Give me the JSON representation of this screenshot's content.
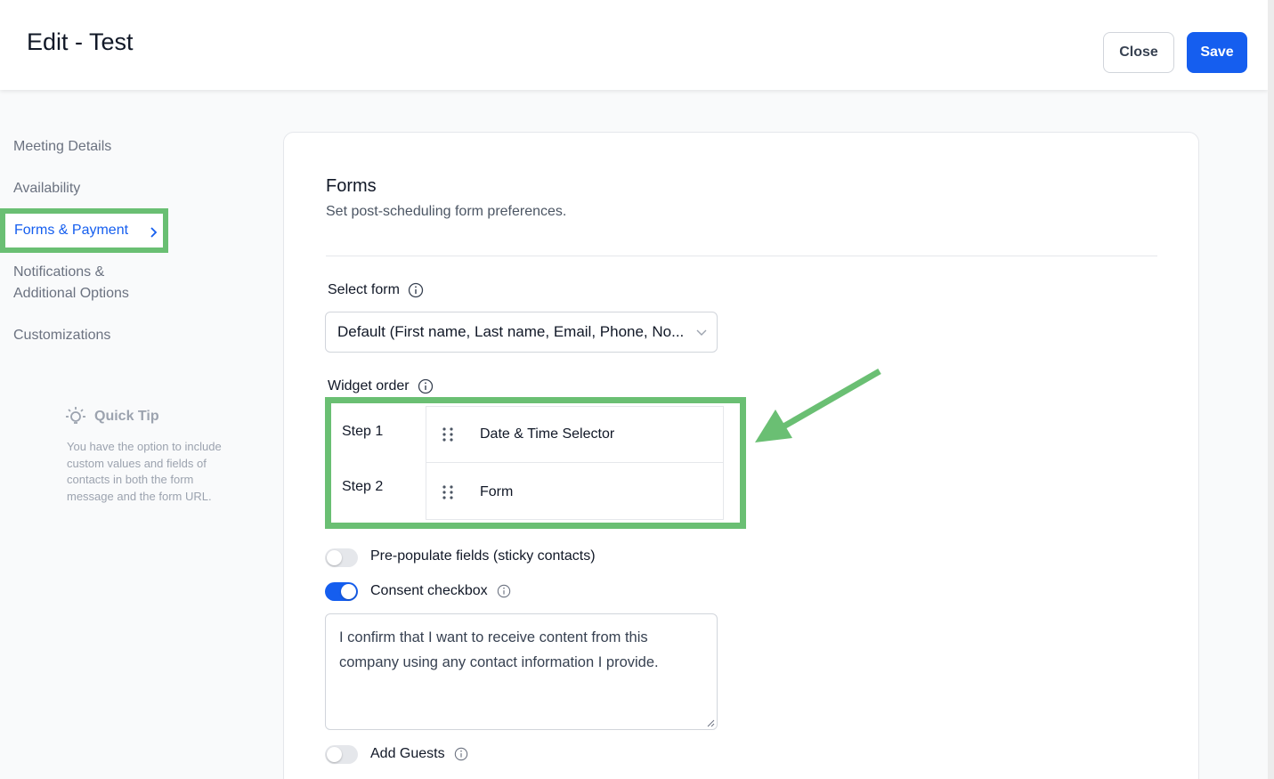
{
  "header": {
    "title": "Edit - Test",
    "close_label": "Close",
    "save_label": "Save"
  },
  "sidebar": {
    "items": [
      {
        "label": "Meeting Details"
      },
      {
        "label": "Availability"
      },
      {
        "label": "Forms & Payment",
        "active": true
      },
      {
        "label_line1": "Notifications &",
        "label_line2": "Additional Options"
      },
      {
        "label": "Customizations"
      }
    ]
  },
  "quick_tip": {
    "title": "Quick Tip",
    "text": "You have the option to include custom values and fields of contacts in both the form message and the form URL."
  },
  "forms": {
    "title": "Forms",
    "subtitle": "Set post-scheduling form preferences.",
    "select_form_label": "Select form",
    "select_form_value": "Default (First name, Last name, Email, Phone, No...",
    "widget_order_label": "Widget order",
    "steps": [
      {
        "label": "Step 1",
        "widget": "Date & Time Selector"
      },
      {
        "label": "Step 2",
        "widget": "Form"
      }
    ],
    "prepopulate_label": "Pre-populate fields (sticky contacts)",
    "prepopulate_on": false,
    "consent_label": "Consent checkbox",
    "consent_on": true,
    "consent_text": "I confirm that I want to receive content from this company using any contact information I provide.",
    "add_guests_label": "Add Guests",
    "add_guests_on": false
  },
  "colors": {
    "accent": "#155eef",
    "highlight": "#6abf73"
  },
  "icons": {
    "info": "info-icon",
    "drag": "drag-handle-icon",
    "bulb": "lightbulb-icon",
    "chevron_right": "chevron-right-icon",
    "chevron_down": "chevron-down-icon"
  }
}
